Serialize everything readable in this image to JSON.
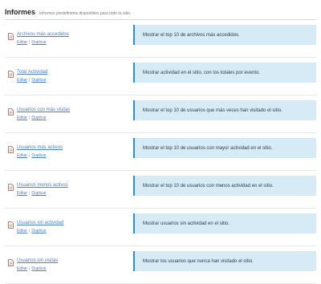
{
  "header": {
    "title": "Informes",
    "subtitle": "Informes predefinidos disponibles para todo tu sitio."
  },
  "actions": {
    "edit": "Editar",
    "separator": "|",
    "duplicate": "Duplicar"
  },
  "reports": [
    {
      "name": "Archivos más accedidos",
      "description": "Mostrar el top 10 de archivos más accedidos."
    },
    {
      "name": "Total Actividad",
      "description": "Mostrar actividad en el sitio, con los totales por evento."
    },
    {
      "name": "Usuarios con más visitas",
      "description": "Mostrar el top 10 de usuarios que más veces han visitado el sitio."
    },
    {
      "name": "Usuarios más activos",
      "description": "Mostrar el top 10 de usuarios con mayor actividad en el sitio."
    },
    {
      "name": "Usuarios menos activos",
      "description": "Mostrar el top 10 de usuarios con menos actividad en el sitio."
    },
    {
      "name": "Usuarios sin actividad",
      "description": "Mostrar usuarios sin actividad en el sitio."
    },
    {
      "name": "Usuarios sin visitas",
      "description": "Mostrar los usuarios que nunca han visitado el sitio."
    }
  ],
  "icons": {
    "report": "report-document-icon"
  },
  "colors": {
    "link": "#4a7fc0",
    "description_bg": "#d7ebf6",
    "description_accent": "#2e8dca"
  }
}
